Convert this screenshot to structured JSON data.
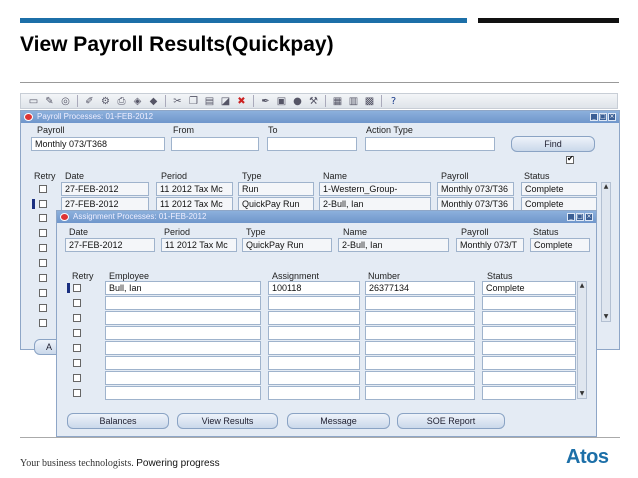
{
  "slide": {
    "title": "View Payroll Results(Quickpay)",
    "tagline_normal": "Your business technologists. ",
    "tagline_bold": "Powering progress",
    "logo": "Atos"
  },
  "toolbar": {
    "icons": [
      "open-icon",
      "flashlight-icon",
      "navigate-icon",
      "edit-icon",
      "zoom-icon",
      "print-icon",
      "attachment-icon",
      "translate-icon",
      "cut-icon",
      "copy-icon",
      "paste-icon",
      "clear-icon",
      "delete-icon",
      "pen-icon",
      "folder-icon",
      "sphere-icon",
      "tools-icon",
      "window-icon",
      "calendar-icon",
      "folder-tools-icon",
      "help-icon"
    ]
  },
  "payroll_window": {
    "title": "Payroll Processes: 01-FEB-2012",
    "labels": {
      "payroll": "Payroll",
      "from": "From",
      "to": "To",
      "action_type": "Action Type"
    },
    "payroll_value": "Monthly 073/T368",
    "find_label": "Find",
    "find_checked": true,
    "columns": [
      "Retry",
      "Date",
      "Period",
      "Type",
      "Name",
      "Payroll",
      "Status"
    ],
    "rows": [
      {
        "date": "27-FEB-2012",
        "period": "11 2012 Tax Mc",
        "type": "Run",
        "name": "1-Western_Group-",
        "payroll": "Monthly 073/T36",
        "status": "Complete"
      },
      {
        "date": "27-FEB-2012",
        "period": "11 2012 Tax Mc",
        "type": "QuickPay Run",
        "name": "2-Bull, Ian",
        "payroll": "Monthly 073/T36",
        "status": "Complete"
      }
    ],
    "obscured_button": "A"
  },
  "assignment_window": {
    "title": "Assignment Processes: 01-FEB-2012",
    "header_labels": {
      "date": "Date",
      "period": "Period",
      "type": "Type",
      "name": "Name",
      "payroll": "Payroll",
      "status": "Status"
    },
    "header_values": {
      "date": "27-FEB-2012",
      "period": "11 2012 Tax Mc",
      "type": "QuickPay Run",
      "name": "2-Bull, Ian",
      "payroll": "Monthly 073/T",
      "status": "Complete"
    },
    "columns": {
      "retry": "Retry",
      "employee": "Employee",
      "assignment": "Assignment",
      "number": "Number",
      "status": "Status"
    },
    "rows": [
      {
        "employee": "Bull, Ian",
        "assignment": "100118",
        "number": "26377134",
        "status": "Complete"
      }
    ],
    "buttons": {
      "balances": "Balances",
      "view_results": "View Results",
      "message": "Message",
      "soe_report": "SOE Report"
    }
  }
}
